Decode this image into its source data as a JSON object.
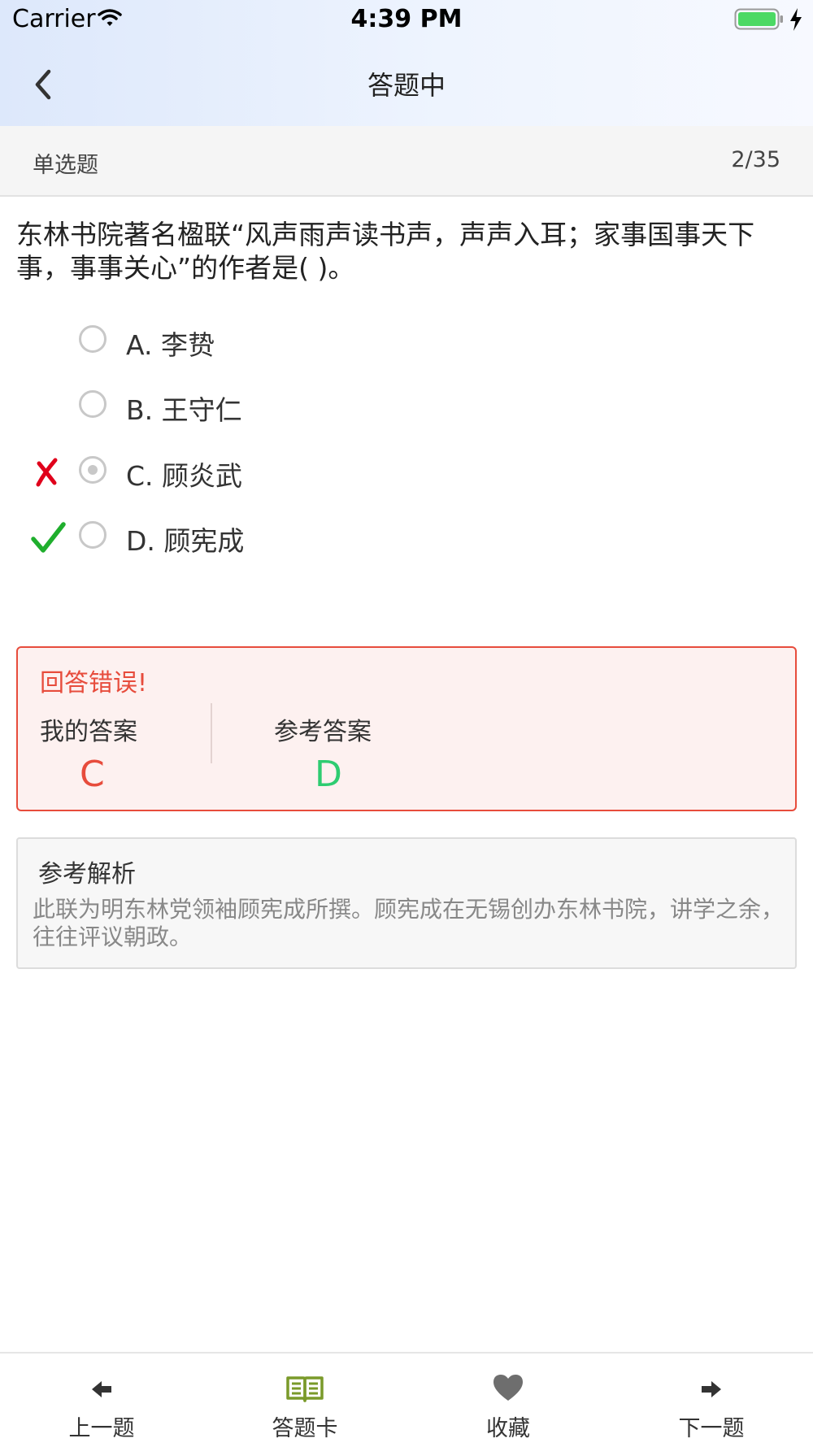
{
  "status_bar": {
    "carrier": "Carrier",
    "time": "4:39 PM"
  },
  "nav": {
    "title": "答题中",
    "back_icon": "chevron-left-icon"
  },
  "question_bar": {
    "type": "单选题",
    "progress": "2/35"
  },
  "question": {
    "text": "东林书院著名楹联“风声雨声读书声，声声入耳；家事国事天下事，事事关心”的作者是(    )。",
    "options": [
      {
        "label": "A. 李贽",
        "selected": false,
        "mark": ""
      },
      {
        "label": "B. 王守仁",
        "selected": false,
        "mark": ""
      },
      {
        "label": "C. 顾炎武",
        "selected": true,
        "mark": "wrong"
      },
      {
        "label": "D. 顾宪成",
        "selected": false,
        "mark": "correct"
      }
    ]
  },
  "result": {
    "title": "回答错误!",
    "my_answer_label": "我的答案",
    "my_answer": "C",
    "reference_label": "参考答案",
    "reference_answer": "D"
  },
  "analysis": {
    "title": "参考解析",
    "text": "此联为明东林党领袖顾宪成所撰。顾宪成在无锡创办东林书院，讲学之余，往往评议朝政。"
  },
  "tabbar": {
    "items": [
      {
        "label": "上一题",
        "icon": "arrow-left-icon"
      },
      {
        "label": "答题卡",
        "icon": "book-icon"
      },
      {
        "label": "收藏",
        "icon": "heart-icon"
      },
      {
        "label": "下一题",
        "icon": "arrow-right-icon"
      }
    ]
  },
  "colors": {
    "wrong": "#e74c3c",
    "correct": "#2ecc71",
    "answer_card_icon": "#7a9a2a"
  }
}
